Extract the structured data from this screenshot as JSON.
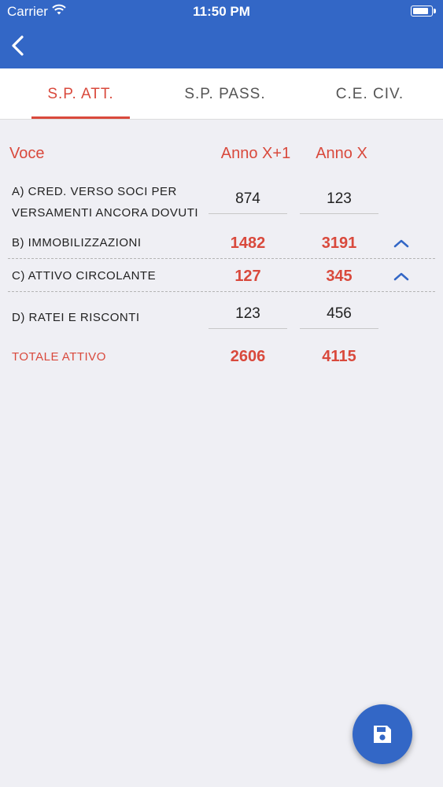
{
  "status_bar": {
    "carrier": "Carrier",
    "time": "11:50 PM"
  },
  "nav": {
    "back_icon": "chevron-left-icon"
  },
  "tabs": [
    {
      "label": "S.P. ATT.",
      "active": true
    },
    {
      "label": "S.P. PASS.",
      "active": false
    },
    {
      "label": "C.E. CIV.",
      "active": false
    }
  ],
  "table": {
    "headers": {
      "voce": "Voce",
      "anno_x1": "Anno X+1",
      "anno_x": "Anno X"
    },
    "rows": [
      {
        "line1": "A) CRED. VERSO SOCI PER",
        "line2": "VERSAMENTI ANCORA DOVUTI",
        "anno_x1": "874",
        "anno_x": "123",
        "editable": true
      },
      {
        "label": "B) IMMOBILIZZAZIONI",
        "anno_x1": "1482",
        "anno_x": "3191",
        "expandable": true
      },
      {
        "label": "C) ATTIVO CIRCOLANTE",
        "anno_x1": "127",
        "anno_x": "345",
        "expandable": true
      },
      {
        "label": "D) RATEI E RISCONTI",
        "anno_x1": "123",
        "anno_x": "456",
        "editable": true
      }
    ],
    "total": {
      "label": "TOTALE ATTIVO",
      "anno_x1": "2606",
      "anno_x": "4115"
    }
  },
  "fab": {
    "icon": "save-icon"
  },
  "colors": {
    "primary": "#3367c6",
    "accent": "#d9493c",
    "background": "#efeff4"
  }
}
